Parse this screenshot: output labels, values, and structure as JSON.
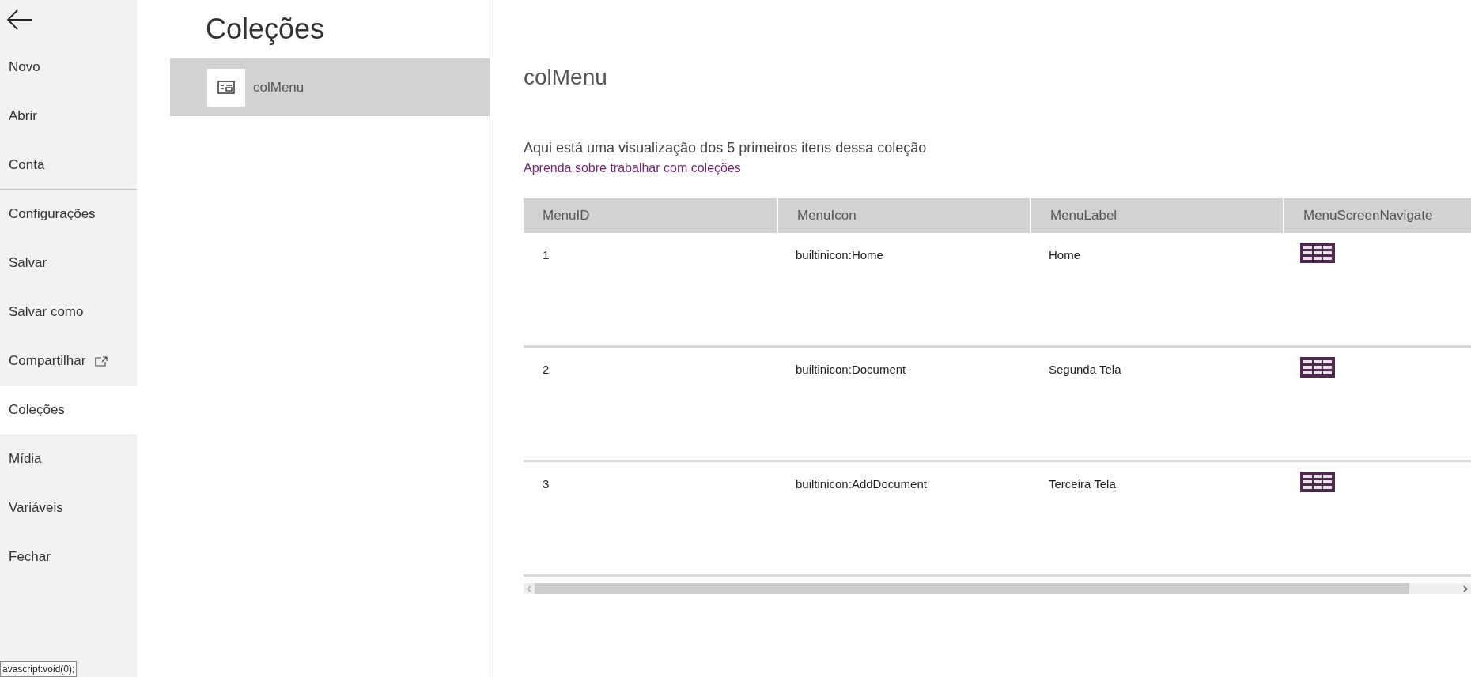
{
  "sidebar": {
    "items": [
      {
        "label": "Novo",
        "selected": false,
        "external": false,
        "divider_after": false
      },
      {
        "label": "Abrir",
        "selected": false,
        "external": false,
        "divider_after": false
      },
      {
        "label": "Conta",
        "selected": false,
        "external": false,
        "divider_after": true
      },
      {
        "label": "Configurações",
        "selected": false,
        "external": false,
        "divider_after": false
      },
      {
        "label": "Salvar",
        "selected": false,
        "external": false,
        "divider_after": false
      },
      {
        "label": "Salvar como",
        "selected": false,
        "external": false,
        "divider_after": false
      },
      {
        "label": "Compartilhar",
        "selected": false,
        "external": true,
        "divider_after": false
      },
      {
        "label": "Coleções",
        "selected": true,
        "external": false,
        "divider_after": false
      },
      {
        "label": "Mídia",
        "selected": false,
        "external": false,
        "divider_after": false
      },
      {
        "label": "Variáveis",
        "selected": false,
        "external": false,
        "divider_after": false
      },
      {
        "label": "Fechar",
        "selected": false,
        "external": false,
        "divider_after": false
      }
    ]
  },
  "page_title": "Coleções",
  "collections": [
    {
      "name": "colMenu",
      "selected": true
    }
  ],
  "detail": {
    "title": "colMenu",
    "description": "Aqui está uma visualização dos 5 primeiros itens dessa coleção",
    "link": "Aprenda sobre trabalhar com coleções",
    "table": {
      "columns": [
        "MenuID",
        "MenuIcon",
        "MenuLabel",
        "MenuScreenNavigate"
      ],
      "rows": [
        {
          "cells": [
            "1",
            "builtinicon:Home",
            "Home"
          ]
        },
        {
          "cells": [
            "2",
            "builtinicon:Document",
            "Segunda Tela"
          ]
        },
        {
          "cells": [
            "3",
            "builtinicon:AddDocument",
            "Terceira Tela"
          ]
        }
      ]
    }
  },
  "status_tooltip": "avascript:void(0);"
}
